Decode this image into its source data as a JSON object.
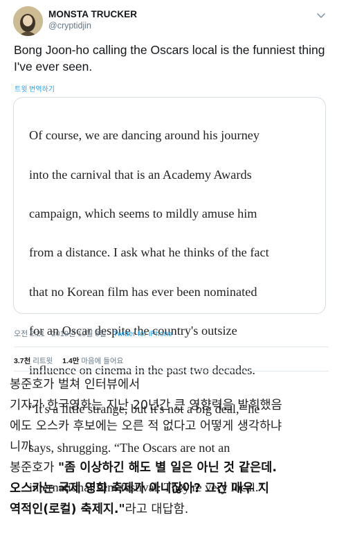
{
  "tweet": {
    "display_name": "MONSTA TRUCKER",
    "handle": "@cryptidjin",
    "text": "Bong Joon-ho calling the Oscars local is the funniest thing I've ever seen.",
    "translate_label": "트윗 번역하기",
    "quote_lines": [
      "Of course, we are dancing around his journey",
      "into the carnival that is an Academy Awards",
      "campaign, which seems to mildly amuse him",
      "from a distance. I ask what he thinks of the fact",
      "that no Korean film has ever been nominated",
      "for an Oscar despite the country's outsize",
      "influence on cinema in the past two decades.",
      "“It's a little strange, but it's not a big deal,” he",
      "says, shrugging. “The Oscars are not an",
      "international film festival. They're very local.”"
    ],
    "timestamp": "오전 2:21 · 2019년 10월 8일 ·",
    "source": "Twitter for iPhone",
    "retweets_count": "3.7천",
    "retweets_label": "리트윗",
    "likes_count": "1.4만",
    "likes_label": "마음에 들어요"
  },
  "caption": {
    "line1": "봉준호가 벌쳐 인터뷰에서",
    "line2": "기자가 한국영화는 지난 20년간 큰 영향력을 발휘했음",
    "line3": "에도 오스카 후보에는 오른 적 없다고 어떻게 생각하냐",
    "line4": "니까",
    "line5_prefix": "봉준호가 ",
    "line5_bold": "\"좀 이상하긴 해도 별 일은 아닌 것 같은데.",
    "line6_bold": "오스카는 국제 영화 축제가 아니잖아? 그건 매우 지",
    "line7_bold": "역적인(로컬) 축제지.\"",
    "line7_suffix": "라고 대답함."
  },
  "icons": {
    "avatar": "avatar-photo",
    "menu": "chevron-down-icon"
  },
  "colors": {
    "link": "#1da1f2",
    "muted": "#657786",
    "border": "#d6dde3"
  }
}
